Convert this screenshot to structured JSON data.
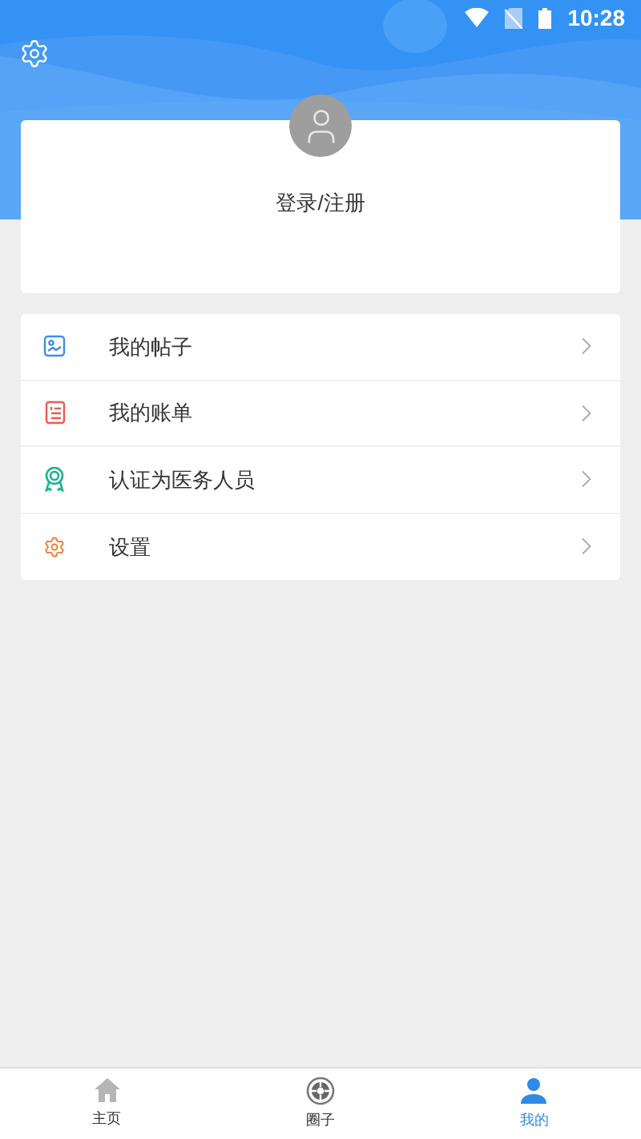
{
  "status_bar": {
    "time": "10:28"
  },
  "profile": {
    "login_label": "登录/注册"
  },
  "menu": [
    {
      "kind": "posts",
      "label": "我的帖子"
    },
    {
      "kind": "bill",
      "label": "我的账单"
    },
    {
      "kind": "cert",
      "label": "认证为医务人员"
    },
    {
      "kind": "settings",
      "label": "设置"
    }
  ],
  "tabs": [
    {
      "kind": "home",
      "label": "主页",
      "selected": false
    },
    {
      "kind": "circle",
      "label": "圈子",
      "selected": false
    },
    {
      "kind": "me",
      "label": "我的",
      "selected": true
    }
  ]
}
